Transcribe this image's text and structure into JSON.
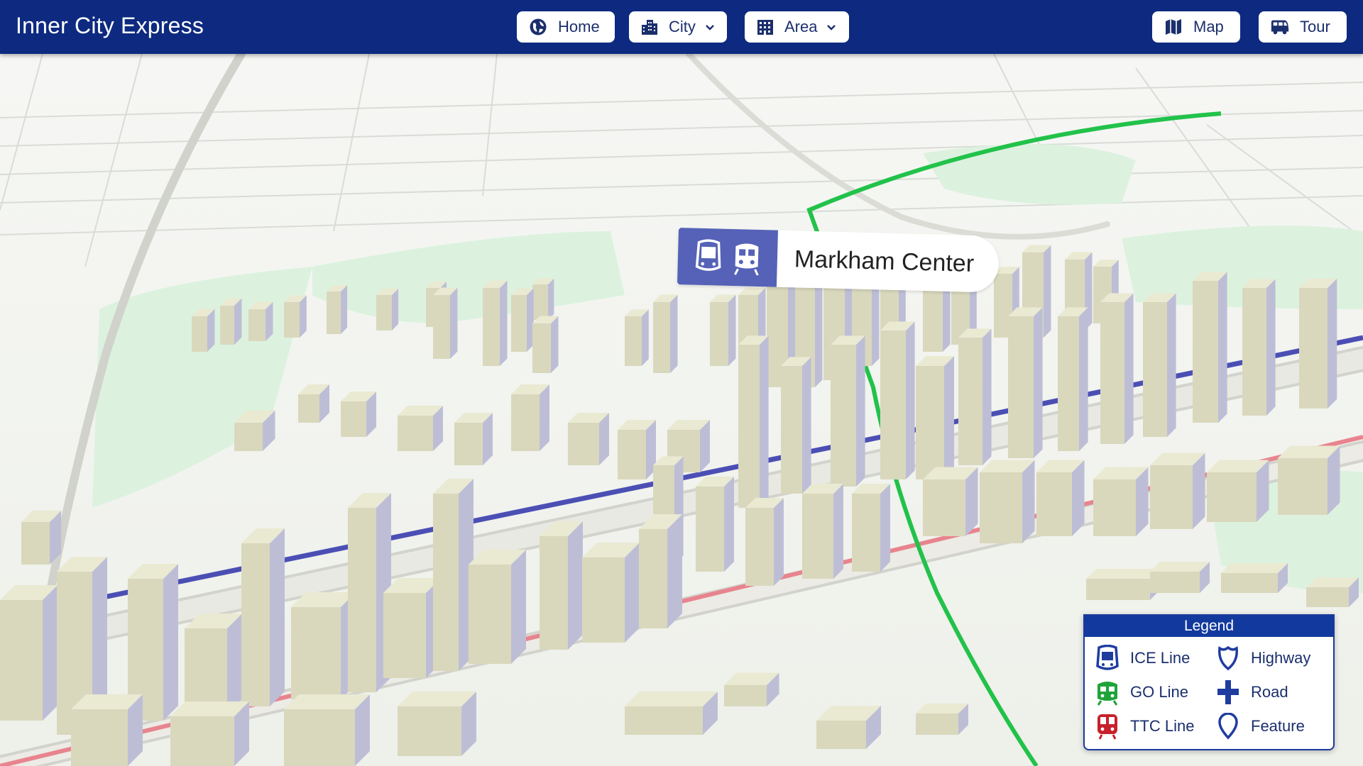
{
  "app": {
    "title": "Inner City Express"
  },
  "nav": {
    "home": "Home",
    "city": "City",
    "area": "Area",
    "map": "Map",
    "tour": "Tour"
  },
  "station": {
    "name": "Markham Center",
    "icons": [
      "tram-icon",
      "train-icon"
    ]
  },
  "legend": {
    "title": "Legend",
    "items": [
      {
        "label": "ICE Line",
        "icon": "tram-icon",
        "color": "#1f3c9f"
      },
      {
        "label": "Highway",
        "icon": "shield-icon",
        "color": "#1f3c9f"
      },
      {
        "label": "GO Line",
        "icon": "train-icon",
        "color": "#1fa33a"
      },
      {
        "label": "Road",
        "icon": "cross-road-icon",
        "color": "#1f3c9f"
      },
      {
        "label": "TTC Line",
        "icon": "subway-icon",
        "color": "#c8202a"
      },
      {
        "label": "Feature",
        "icon": "map-pin-icon",
        "color": "#1f3c9f"
      }
    ]
  },
  "colors": {
    "header": "#0d2a80",
    "ice_line": "#4b4fb4",
    "go_line": "#22c24a",
    "ttc_line": "#e27a86",
    "park": "#d8f0dc",
    "building": "#e6e5cc"
  }
}
